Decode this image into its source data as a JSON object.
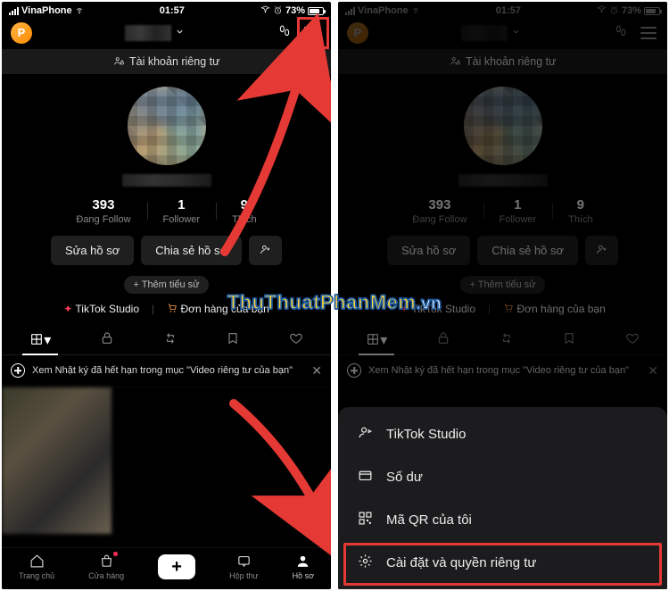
{
  "status": {
    "carrier": "VinaPhone",
    "time": "01:57",
    "battery_pct": "73%"
  },
  "header": {
    "avatar_letter": "P"
  },
  "private_banner": "Tài khoản riêng tư",
  "stats": {
    "following": {
      "num": "393",
      "label": "Đang Follow"
    },
    "followers": {
      "num": "1",
      "label": "Follower"
    },
    "likes": {
      "num": "9",
      "label": "Thích"
    }
  },
  "buttons": {
    "edit_profile": "Sửa hồ sơ",
    "share_profile": "Chia sẻ hồ sơ"
  },
  "add_bio": "+ Thêm tiểu sử",
  "links": {
    "studio": "TikTok Studio",
    "orders": "Đơn hàng của bạn"
  },
  "notice": {
    "text": "Xem Nhật ký đã hết hạn trong mục \"Video riêng tư của bạn\""
  },
  "bottom_nav": {
    "home": "Trang chủ",
    "shop": "Cửa hàng",
    "inbox": "Hộp thư",
    "profile": "Hồ sơ"
  },
  "sheet": {
    "studio": "TikTok Studio",
    "balance": "Số dư",
    "qr": "Mã QR của tôi",
    "settings": "Cài đặt và quyền riêng tư"
  },
  "watermark": {
    "main": "ThuThuatPhanMem",
    "tail": ".vn"
  }
}
